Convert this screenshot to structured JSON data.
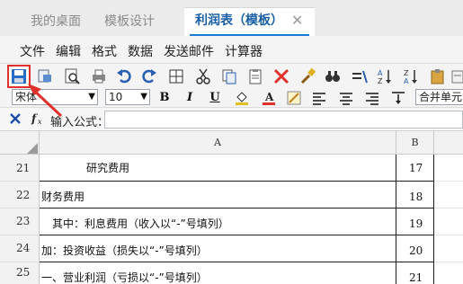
{
  "tabs": [
    {
      "label": "我的桌面"
    },
    {
      "label": "模板设计"
    },
    {
      "label": "利润表（模板）",
      "close": "✕"
    }
  ],
  "menu": [
    "文件",
    "编辑",
    "格式",
    "数据",
    "发送邮件",
    "计算器"
  ],
  "font": {
    "family": "宋体",
    "size": "10",
    "merge_label": "合并单元"
  },
  "formula": {
    "label": "输入公式："
  },
  "columns": [
    "A",
    "B"
  ],
  "rows": [
    {
      "num": "21",
      "a": "研究费用",
      "b": "17"
    },
    {
      "num": "22",
      "a": "财务费用",
      "b": "18"
    },
    {
      "num": "23",
      "a": "其中：利息费用（收入以“-”号填列）",
      "b": "19"
    },
    {
      "num": "24",
      "a": "加：投资收益（损失以“-”号填列）",
      "b": "20"
    },
    {
      "num": "25",
      "a": "一、营业利润（亏损以“-”号填列）",
      "b": "21"
    }
  ],
  "colors": {
    "accent": "#1a7bd5",
    "highlight": "#e0312c"
  }
}
